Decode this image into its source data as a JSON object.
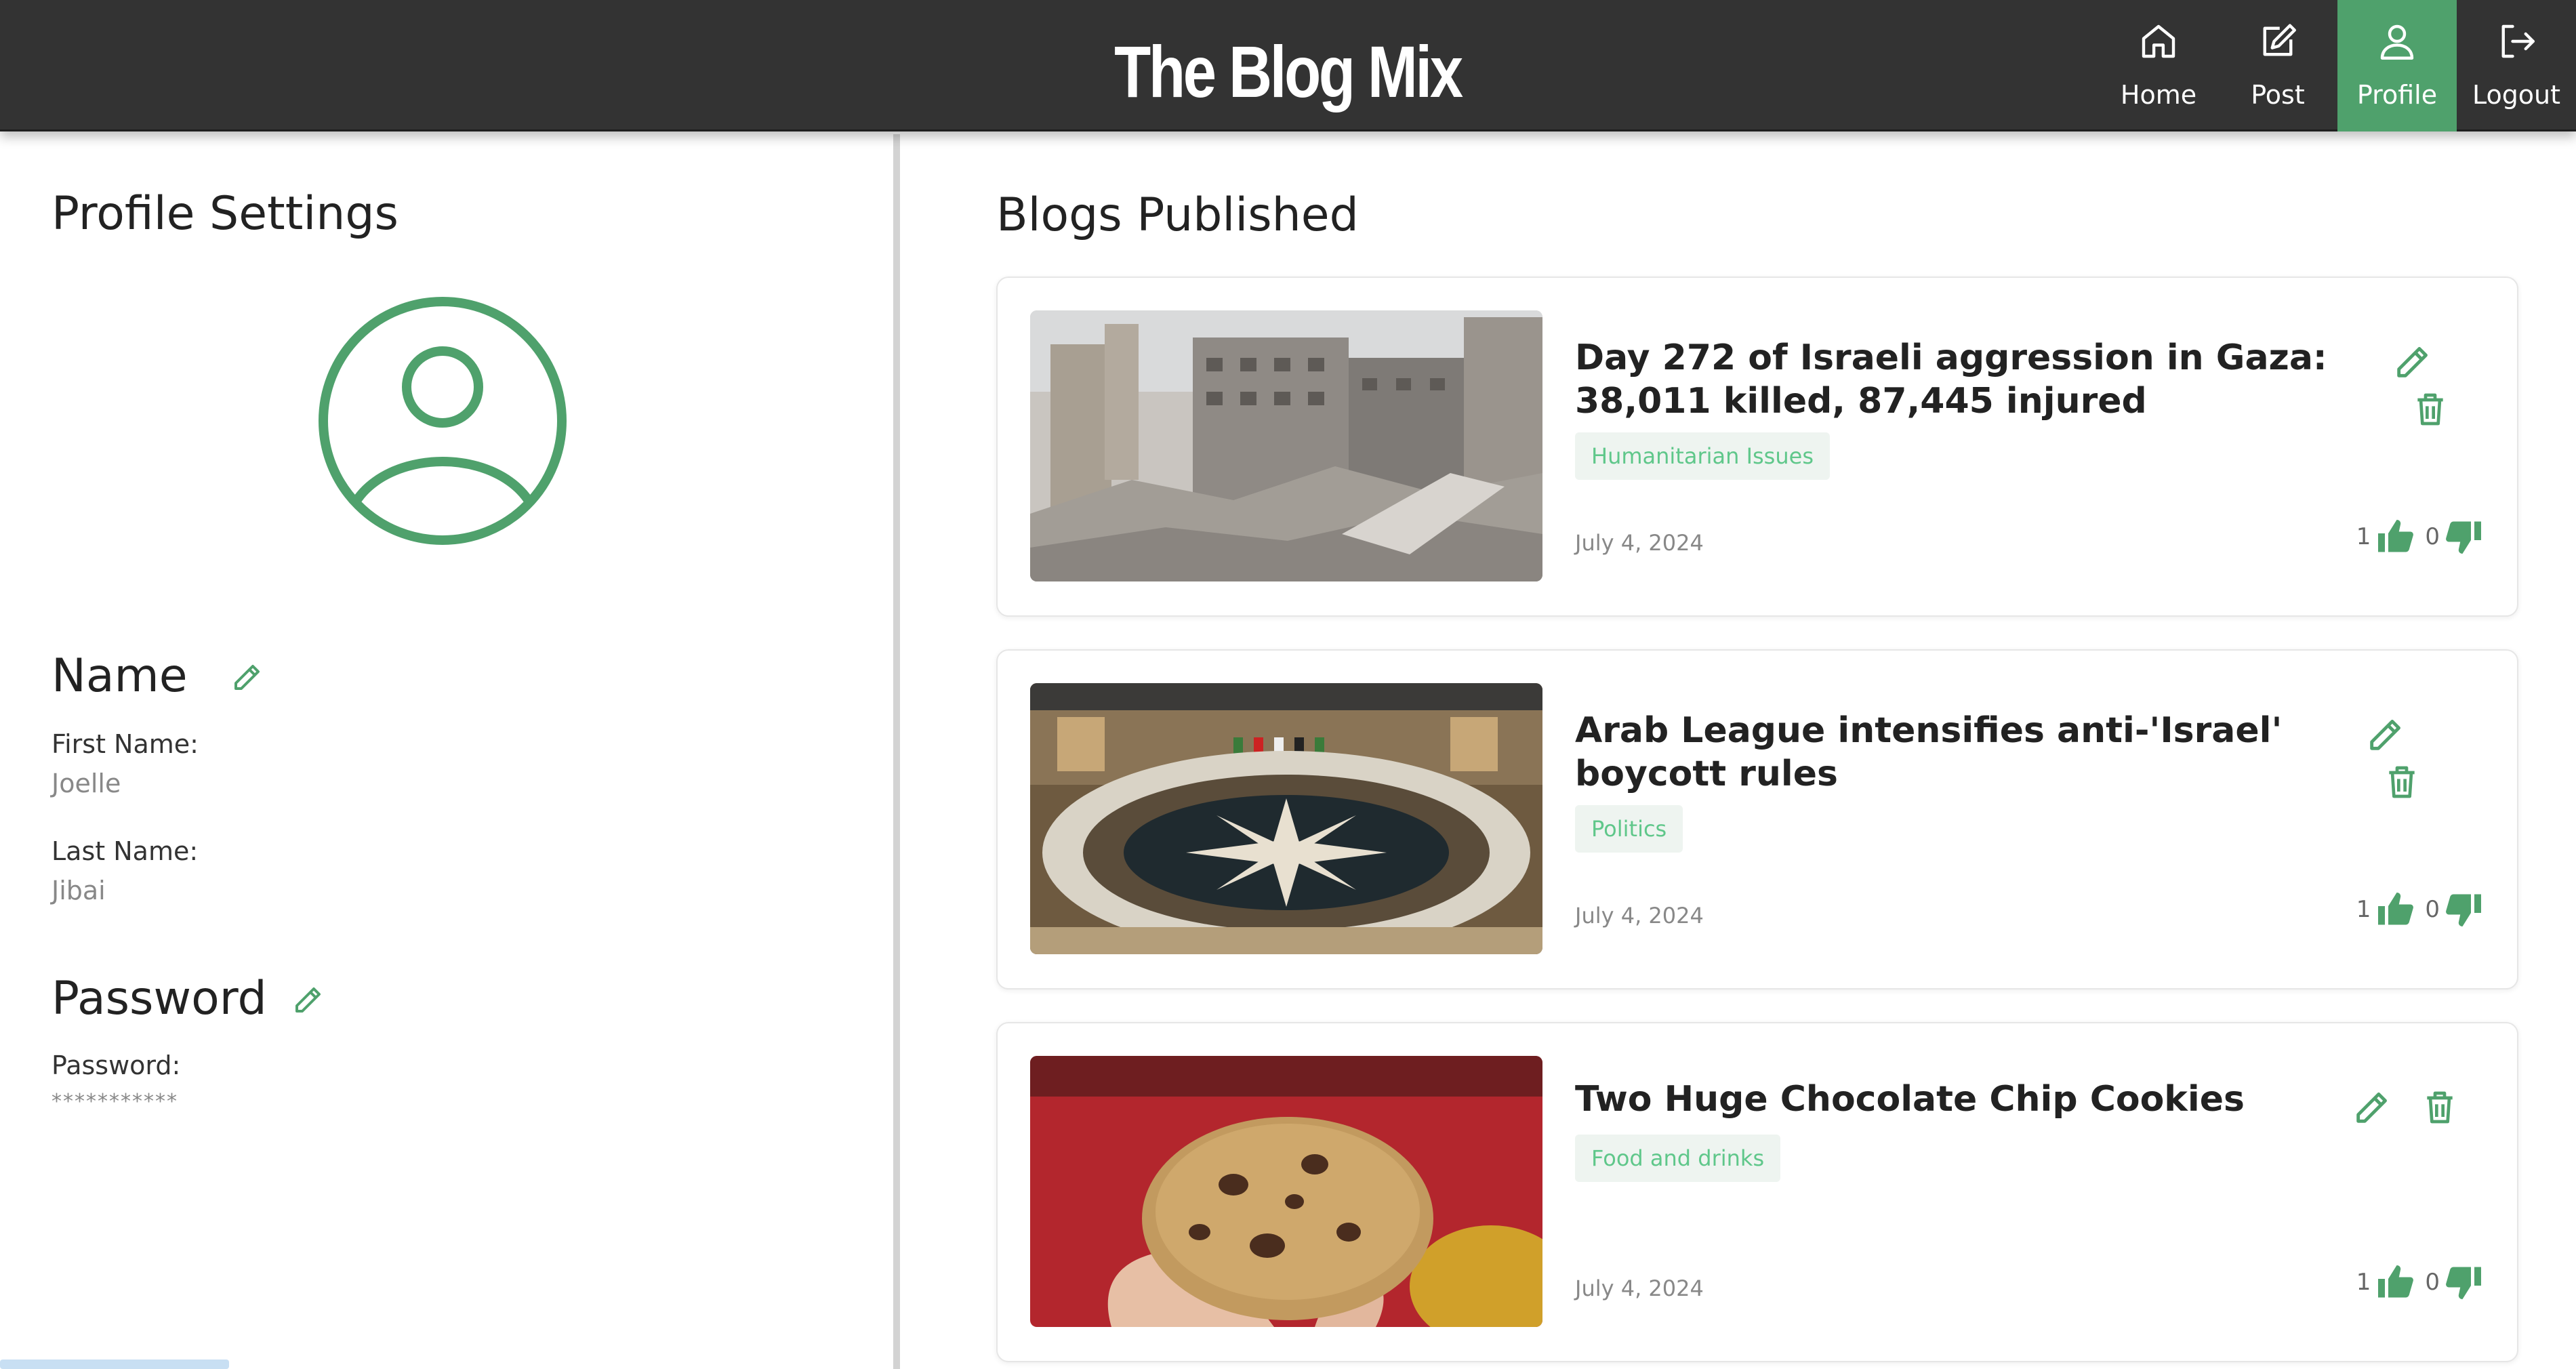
{
  "app": {
    "brand": "The Blog Mix"
  },
  "nav": [
    {
      "label": "Home",
      "icon": "home-icon",
      "active": false
    },
    {
      "label": "Post",
      "icon": "edit-post-icon",
      "active": false
    },
    {
      "label": "Profile",
      "icon": "user-icon",
      "active": true
    },
    {
      "label": "Logout",
      "icon": "logout-icon",
      "active": false
    }
  ],
  "profile": {
    "title": "Profile Settings",
    "name_section": "Name",
    "first_name_label": "First Name:",
    "first_name": "Joelle",
    "last_name_label": "Last Name:",
    "last_name": "Jibai",
    "password_section": "Password",
    "password_label": "Password:",
    "password_value": "***********"
  },
  "blogs": {
    "title": "Blogs Published",
    "items": [
      {
        "title": "Day 272 of Israeli aggression in Gaza: 38,011 killed, 87,445 injured",
        "tag": "Humanitarian Issues",
        "date": "July 4, 2024",
        "likes": "1",
        "dislikes": "0"
      },
      {
        "title": "Arab League intensifies anti-'Israel' boycott rules",
        "tag": "Politics",
        "date": "July 4, 2024",
        "likes": "1",
        "dislikes": "0"
      },
      {
        "title": "Two Huge Chocolate Chip Cookies",
        "tag": "Food and drinks",
        "date": "July 4, 2024",
        "likes": "1",
        "dislikes": "0"
      }
    ]
  },
  "colors": {
    "accent": "#4fa16c",
    "header_bg": "#333333",
    "tag_text": "#5fc78a",
    "tag_bg": "#eef4f0"
  }
}
